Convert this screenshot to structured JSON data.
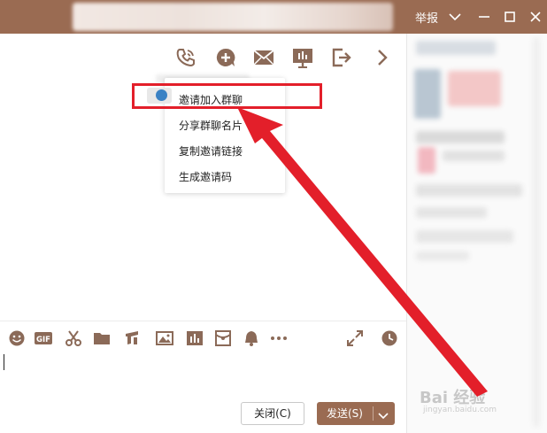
{
  "titlebar": {
    "report_label": "举报"
  },
  "menu": {
    "items": [
      {
        "label": "邀请加入群聊"
      },
      {
        "label": "分享群聊名片"
      },
      {
        "label": "复制邀请链接"
      },
      {
        "label": "生成邀请码"
      }
    ]
  },
  "footer": {
    "close_label": "关闭(C)",
    "send_label": "发送(S)"
  },
  "watermark": {
    "main": "Bai 经验",
    "sub": "jingyan.baidu.com"
  },
  "colors": {
    "titlebar": "#9a6b52",
    "send_button": "#9a6b52",
    "annotation_red": "#e31f2a",
    "icon": "#8b6a58"
  }
}
